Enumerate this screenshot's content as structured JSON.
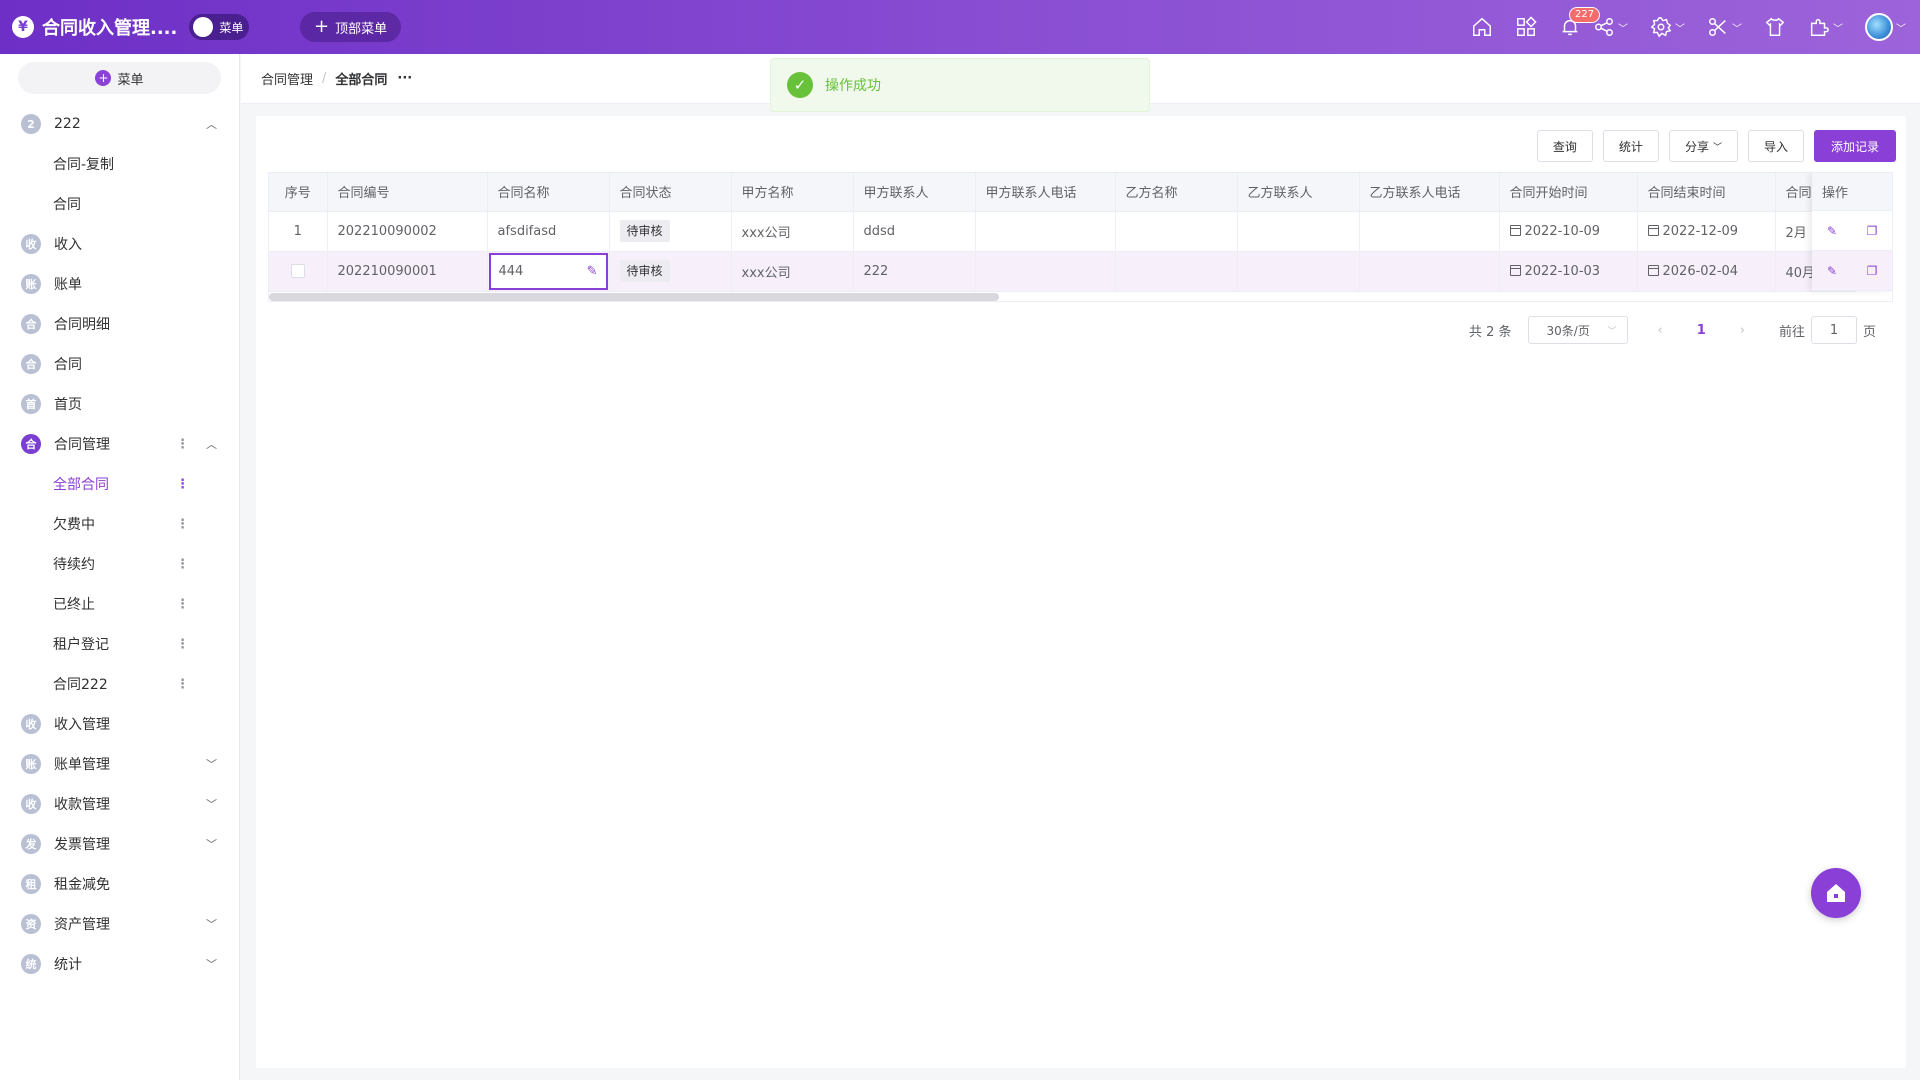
{
  "app": {
    "logo_glyph": "¥",
    "title": "合同收入管理....",
    "menu_toggle_label": "菜单",
    "top_menu_label": "顶部菜单",
    "notification_count": "227",
    "accent_color": "#8a3fd6"
  },
  "topbar_icons": [
    "home-icon",
    "apps-icon",
    "bell-icon",
    "share-icon",
    "settings-icon",
    "tools-icon",
    "shirt-icon",
    "plugin-icon",
    "avatar"
  ],
  "sidebar": {
    "add_label": "菜单",
    "items": [
      {
        "icon": "2",
        "label": "222",
        "arrow": "up"
      },
      {
        "label": "合同-复制",
        "sub": true
      },
      {
        "label": "合同",
        "sub": true
      },
      {
        "icon": "收",
        "label": "收入"
      },
      {
        "icon": "账",
        "label": "账单"
      },
      {
        "icon": "合",
        "label": "合同明细"
      },
      {
        "icon": "合",
        "label": "合同"
      },
      {
        "icon": "首",
        "label": "首页"
      },
      {
        "icon": "合",
        "label": "合同管理",
        "arrow": "up"
      },
      {
        "label": "全部合同",
        "sub": true
      },
      {
        "label": "欠费中",
        "sub": true
      },
      {
        "label": "待续约",
        "sub": true
      },
      {
        "label": "已终止",
        "sub": true
      },
      {
        "label": "租户登记",
        "sub": true
      },
      {
        "label": "合同222",
        "sub": true
      },
      {
        "icon": "收",
        "label": "收入管理"
      },
      {
        "icon": "账",
        "label": "账单管理",
        "arrow": "down"
      },
      {
        "icon": "收",
        "label": "收款管理",
        "arrow": "down"
      },
      {
        "icon": "发",
        "label": "发票管理",
        "arrow": "down"
      },
      {
        "icon": "租",
        "label": "租金减免"
      },
      {
        "icon": "资",
        "label": "资产管理",
        "arrow": "down"
      },
      {
        "icon": "统",
        "label": "统计",
        "arrow": "down"
      }
    ]
  },
  "breadcrumb": {
    "parent": "合同管理",
    "separator": "/",
    "current": "全部合同",
    "more": "···"
  },
  "toast": {
    "message": "操作成功"
  },
  "toolbar": {
    "query": "查询",
    "stats": "统计",
    "share": "分享",
    "import": "导入",
    "add": "添加记录"
  },
  "table": {
    "headers": [
      "序号",
      "合同编号",
      "合同名称",
      "合同状态",
      "甲方名称",
      "甲方联系人",
      "甲方联系人电话",
      "乙方名称",
      "乙方联系人",
      "乙方联系人电话",
      "合同开始时间",
      "合同结束时间",
      "合同"
    ],
    "ops_header": "操作",
    "rows": [
      {
        "seq": "1",
        "code": "202210090002",
        "name": "afsdifasd",
        "status": "待审核",
        "party_a": "xxx公司",
        "a_contact": "ddsd",
        "a_phone": "",
        "party_b": "",
        "b_contact": "",
        "b_phone": "",
        "start": "2022-10-09",
        "end": "2022-12-09",
        "extra": "2月"
      },
      {
        "seq": "",
        "code": "202210090001",
        "name": "444",
        "status": "待审核",
        "party_a": "xxx公司",
        "a_contact": "222",
        "a_phone": "",
        "party_b": "",
        "b_contact": "",
        "b_phone": "",
        "start": "2022-10-03",
        "end": "2026-02-04",
        "extra": "40月"
      }
    ]
  },
  "pager": {
    "total": "共 2 条",
    "page_size": "30条/页",
    "current_page": "1",
    "goto_label": "前往",
    "goto_value": "1",
    "page_suffix": "页"
  }
}
